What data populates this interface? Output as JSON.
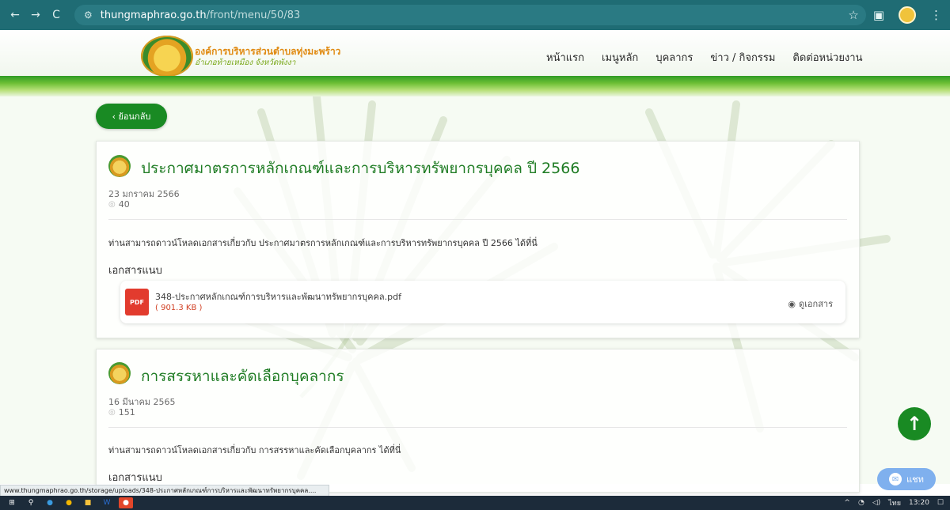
{
  "browser": {
    "url_host": "thungmaphrao.go.th",
    "url_path": "/front/menu/50/83",
    "back_icon": "←",
    "forward_icon": "→",
    "reload_icon": "C"
  },
  "site": {
    "org_name": "องค์การบริหารส่วนตำบลทุ่งมะพร้าว",
    "org_sub": "อำเภอท้ายเหมือง จังหวัดพังงา",
    "nav": [
      "หน้าแรก",
      "เมนูหลัก",
      "บุคลากร",
      "ข่าว / กิจกรรม",
      "ติดต่อหน่วยงาน"
    ]
  },
  "back_button": "‹ ย้อนกลับ",
  "posts": [
    {
      "title": "ประกาศมาตรการหลักเกณฑ์และการบริหารทรัพยากรบุคคล ปี 2566",
      "date": "23 มกราคม 2566",
      "views": "40",
      "description": "ท่านสามารถดาวน์โหลดเอกสารเกี่ยวกับ ประกาศมาตรการหลักเกณฑ์และการบริหารทรัพยากรบุคคล ปี 2566 ได้ที่นี่",
      "attachments_heading": "เอกสารแนบ",
      "file": {
        "badge": "PDF",
        "name": "348-ประกาศหลักเกณฑ์การบริหารและพัฒนาทรัพยากรบุคคล.pdf",
        "size": "( 901.3 KB )",
        "view_label": "ดูเอกสาร"
      }
    },
    {
      "title": "การสรรหาและคัดเลือกบุคลากร",
      "date": "16 มีนาคม 2565",
      "views": "151",
      "description": "ท่านสามารถดาวน์โหลดเอกสารเกี่ยวกับ การสรรหาและคัดเลือกบุคลากร ได้ที่นี่",
      "attachments_heading": "เอกสารแนบ"
    }
  ],
  "chat_label": "แชท",
  "status_url": "www.thungmaphrao.go.th/storage/uploads/348-ประกาศหลักเกณฑ์การบริหารและพัฒนาทรัพยากรบุคคล....",
  "taskbar": {
    "lang": "ไทย",
    "time": "13:20"
  },
  "colors": {
    "brand_green": "#198a23",
    "title_green": "#1f7c24",
    "browser_teal": "#1f6c74",
    "pdf_red": "#e23b2e"
  }
}
